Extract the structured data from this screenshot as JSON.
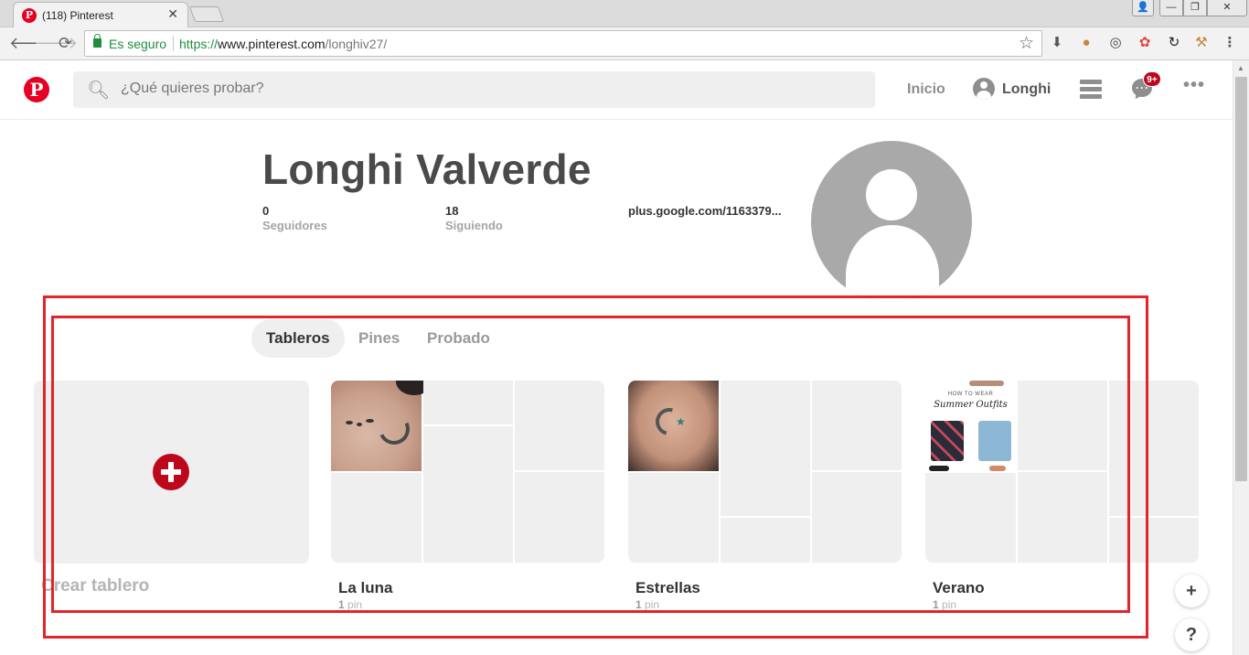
{
  "browser": {
    "tab_title": "(118) Pinterest",
    "tab_close": "✕",
    "secure_label": "Es seguro",
    "url_scheme": "https://",
    "url_host": "www.pinterest.com",
    "url_path": "/longhiv27/",
    "window_buttons": {
      "user": "👤",
      "minimize": "—",
      "maximize": "❐",
      "close": "✕"
    }
  },
  "header": {
    "logo": "P",
    "search_placeholder": "¿Qué quieres probar?",
    "inicio": "Inicio",
    "username": "Longhi",
    "notification_badge": "9+",
    "more": "•••"
  },
  "profile": {
    "name": "Longhi Valverde",
    "followers_count": "0",
    "followers_label": "Seguidores",
    "following_count": "18",
    "following_label": "Siguiendo",
    "website": "plus.google.com/1163379..."
  },
  "tabs": [
    {
      "label": "Tableros",
      "active": true
    },
    {
      "label": "Pines",
      "active": false
    },
    {
      "label": "Probado",
      "active": false
    }
  ],
  "boards": {
    "create_label": "Crear tablero",
    "items": [
      {
        "title": "La luna",
        "count": "1",
        "unit": "pin"
      },
      {
        "title": "Estrellas",
        "count": "1",
        "unit": "pin"
      },
      {
        "title": "Verano",
        "count": "1",
        "unit": "pin"
      }
    ],
    "verano_thumb_small": "HOW TO WEAR",
    "verano_thumb_title": "Summer Outfits"
  },
  "fab": {
    "add": "+",
    "help": "?"
  },
  "colors": {
    "brand": "#e60023",
    "annotation": "#e3242b",
    "secure": "#1e8e3e"
  }
}
